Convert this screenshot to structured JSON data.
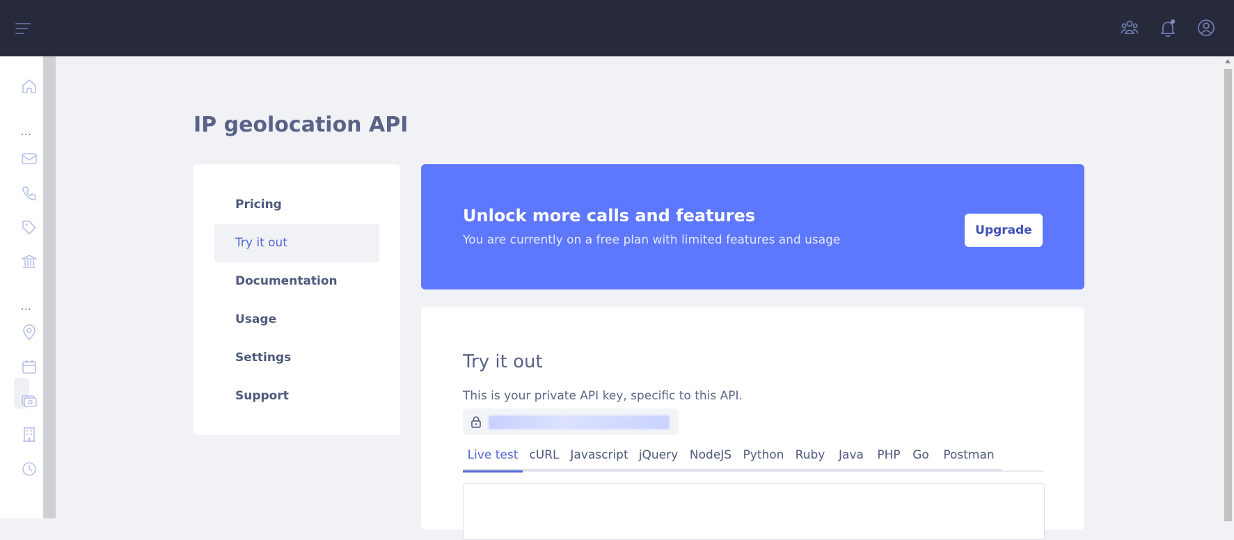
{
  "page": {
    "title": "IP geolocation API"
  },
  "topbar": {
    "icons": [
      "menu-icon",
      "users-icon",
      "bell-icon",
      "user-circle-icon"
    ]
  },
  "sidebar": {
    "dots_1": "...",
    "dots_2": "...",
    "icons": [
      "home-icon",
      "mail-icon",
      "phone-icon",
      "tag-icon",
      "bank-icon",
      "location-pin-icon",
      "calendar-icon",
      "money-icon",
      "building-icon",
      "clock-icon"
    ]
  },
  "nav": {
    "items": [
      {
        "label": "Pricing"
      },
      {
        "label": "Try it out"
      },
      {
        "label": "Documentation"
      },
      {
        "label": "Usage"
      },
      {
        "label": "Settings"
      },
      {
        "label": "Support"
      }
    ],
    "active": "Try it out"
  },
  "banner": {
    "title": "Unlock more calls and features",
    "subtitle": "You are currently on a free plan with limited features and usage",
    "button_label": "Upgrade"
  },
  "tryout": {
    "title": "Try it out",
    "description": "This is your private API key, specific to this API.",
    "api_key_masked": "••••••••••••••••••••••••••••••",
    "tabs": [
      {
        "label": "Live test"
      },
      {
        "label": "cURL"
      },
      {
        "label": "Javascript"
      },
      {
        "label": "jQuery"
      },
      {
        "label": "NodeJS"
      },
      {
        "label": "Python"
      },
      {
        "label": "Ruby"
      },
      {
        "label": "Java"
      },
      {
        "label": "PHP"
      },
      {
        "label": "Go"
      },
      {
        "label": "Postman"
      }
    ],
    "active_tab": "Live test"
  },
  "colors": {
    "topbar_bg": "#262a3b",
    "accent": "#5468d4",
    "banner_bg": "#5d77fd",
    "page_bg": "#f1f2f6"
  }
}
